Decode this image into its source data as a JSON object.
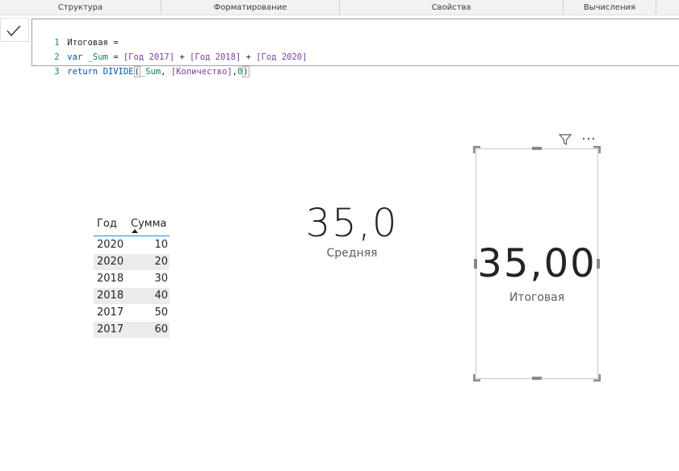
{
  "ribbon": {
    "sections": [
      "Структура",
      "Форматирование",
      "Свойства",
      "Вычисления"
    ]
  },
  "formula_bar": {
    "line_numbers": [
      "1",
      "2",
      "3"
    ],
    "line1": "Итоговая =",
    "line2": {
      "kw": "var",
      "var": "_Sum",
      "eq": " = ",
      "ref1": "[Год 2017]",
      "plus": " + ",
      "ref2": "[Год 2018]",
      "ref3": "[Год 2020]"
    },
    "line3": {
      "kw": "return",
      "fn": "DIVIDE",
      "open": "(",
      "var": "_Sum",
      "comma": ", ",
      "ref": "[Количество]",
      "comma2": ",",
      "num": "0",
      "close": ")"
    }
  },
  "table": {
    "columns": [
      "Год",
      "Сумма"
    ],
    "rows": [
      [
        "2020",
        "10"
      ],
      [
        "2020",
        "20"
      ],
      [
        "2018",
        "30"
      ],
      [
        "2018",
        "40"
      ],
      [
        "2017",
        "50"
      ],
      [
        "2017",
        "60"
      ]
    ]
  },
  "card_avg": {
    "value": "35,0",
    "label": "Средняя"
  },
  "card_total": {
    "value": "35,00",
    "label": "Итоговая"
  },
  "icons": {
    "commit": "checkmark-icon",
    "filter": "filter-icon",
    "more": "more-options-icon"
  }
}
